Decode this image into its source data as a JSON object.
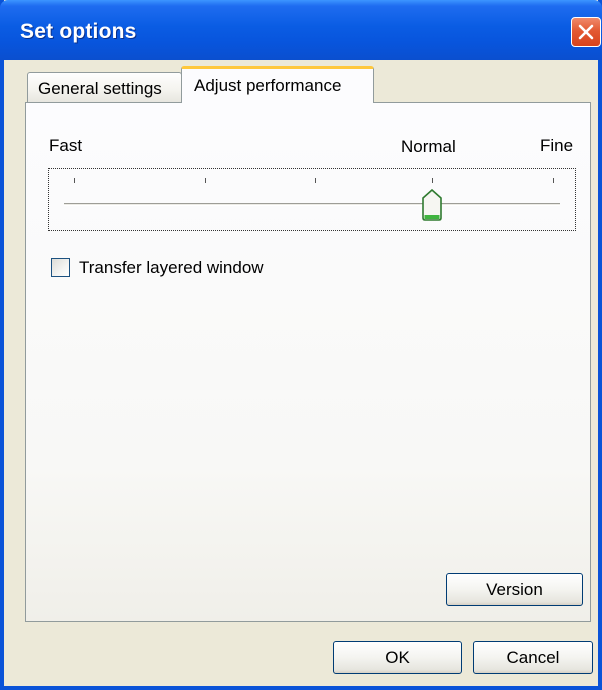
{
  "window": {
    "title": "Set options"
  },
  "tabs": [
    {
      "label": "General settings",
      "active": false
    },
    {
      "label": "Adjust performance",
      "active": true
    }
  ],
  "performance": {
    "label_fast": "Fast",
    "label_normal": "Normal",
    "label_fine": "Fine",
    "slider_value": "Normal",
    "slider_ticks": 5
  },
  "options": {
    "transfer_layered_window_label": "Transfer layered window",
    "transfer_layered_window_checked": false
  },
  "buttons": {
    "version": "Version",
    "ok": "OK",
    "cancel": "Cancel"
  },
  "colors": {
    "titlebar": "#0a5ce3",
    "active_tab_accent": "#ffc83c",
    "close_button": "#e35a33",
    "dialog_face": "#ece9d8"
  },
  "icons": {
    "close": "close-x-icon",
    "slider_thumb": "slider-thumb-icon"
  }
}
